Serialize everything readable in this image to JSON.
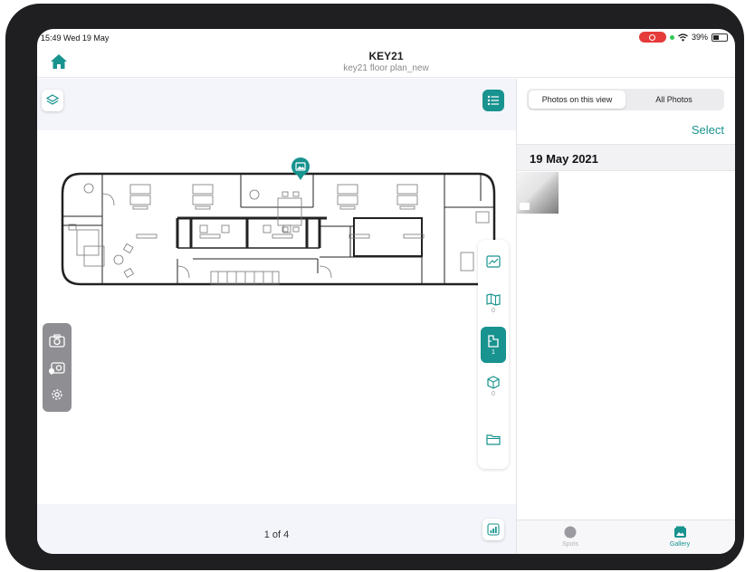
{
  "status_bar": {
    "time": "15:49",
    "date": "Wed 19 May",
    "battery": "39%"
  },
  "header": {
    "title": "KEY21",
    "subtitle": "key21 floor plan_new"
  },
  "map": {
    "pager": "1 of 4",
    "view_counts": {
      "map": "0",
      "floorplan": "1",
      "model": "0"
    },
    "active_view": "floorplan"
  },
  "gallery": {
    "segment_left": "Photos on this view",
    "segment_right": "All Photos",
    "active_segment": "Photos on this view",
    "select_label": "Select",
    "group_date": "19 May 2021"
  },
  "tabs": {
    "spots": "Spots",
    "gallery": "Gallery",
    "active": "Gallery"
  },
  "colors": {
    "accent": "#18938f",
    "tool_bar": "#8e8e93",
    "record": "#e53b3b"
  }
}
